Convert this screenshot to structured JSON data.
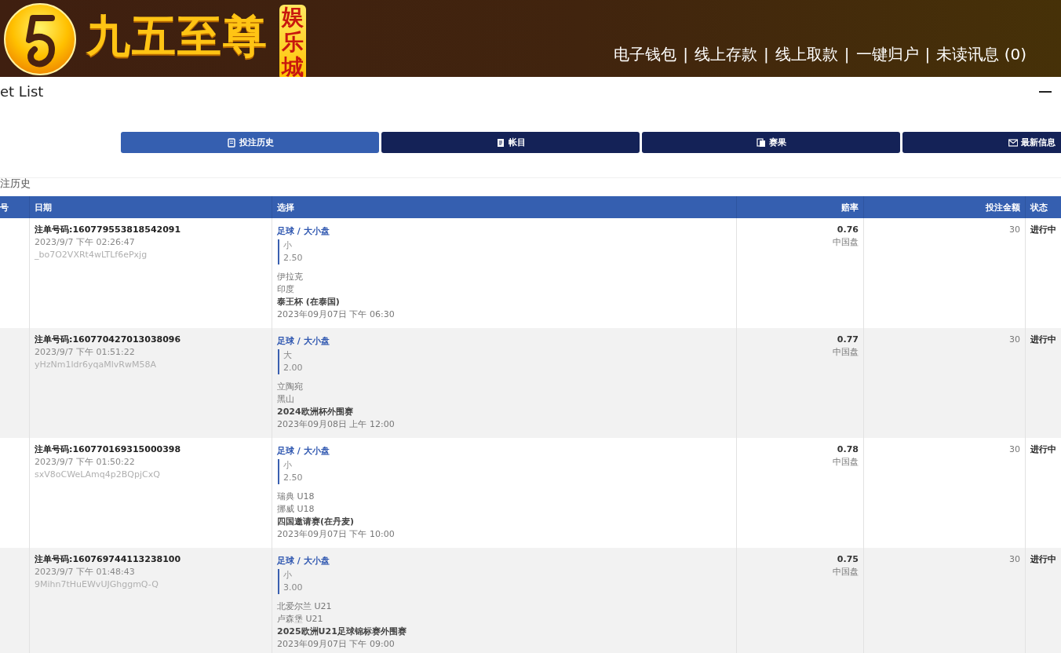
{
  "header": {
    "logo_title": "九五至尊",
    "logo_badge": "娱乐城",
    "nav_links": [
      {
        "label": "电子钱包"
      },
      {
        "label": "线上存款"
      },
      {
        "label": "线上取款"
      },
      {
        "label": "一键归户"
      },
      {
        "label": "未读讯息 (0)"
      }
    ],
    "separator": "|"
  },
  "modal": {
    "title": "et List",
    "tabs": [
      {
        "label": "投注历史",
        "kind": "history",
        "selected": true
      },
      {
        "label": "帐目",
        "kind": "account",
        "selected": false
      },
      {
        "label": "赛果",
        "kind": "results",
        "selected": false
      },
      {
        "label": "最新信息",
        "kind": "messages",
        "selected": false
      }
    ],
    "section_title": "注历史",
    "table": {
      "columns": [
        "号",
        "日期",
        "选择",
        "赔率",
        "投注金额",
        "状态"
      ],
      "rows": [
        {
          "bet_no": "注单号码:160779553818542091",
          "placed": "2023/9/7 下午 02:26:47",
          "ref": "_bo7O2VXRt4wLTLf6ePxjg",
          "market": "足球 / 大小盘",
          "pick": "小",
          "line": "2.50",
          "home": "伊拉克",
          "away": "印度",
          "league": "泰王杯 (在泰国)",
          "kickoff": "2023年09月07日 下午 06:30",
          "odds": "0.76",
          "odds_type": "中国盘",
          "stake": "30",
          "status": "进行中"
        },
        {
          "bet_no": "注单号码:160770427013038096",
          "placed": "2023/9/7 下午 01:51:22",
          "ref": "yHzNm1ldr6yqaMlvRwM58A",
          "market": "足球 / 大小盘",
          "pick": "大",
          "line": "2.00",
          "home": "立陶宛",
          "away": "黑山",
          "league": "2024欧洲杯外围赛",
          "kickoff": "2023年09月08日 上午 12:00",
          "odds": "0.77",
          "odds_type": "中国盘",
          "stake": "30",
          "status": "进行中"
        },
        {
          "bet_no": "注单号码:160770169315000398",
          "placed": "2023/9/7 下午 01:50:22",
          "ref": "sxV8oCWeLAmq4p2BQpjCxQ",
          "market": "足球 / 大小盘",
          "pick": "小",
          "line": "2.50",
          "home": "瑞典 U18",
          "away": "挪威 U18",
          "league": "四国邀请赛(在丹麦)",
          "kickoff": "2023年09月07日 下午 10:00",
          "odds": "0.78",
          "odds_type": "中国盘",
          "stake": "30",
          "status": "进行中"
        },
        {
          "bet_no": "注单号码:160769744113238100",
          "placed": "2023/9/7 下午 01:48:43",
          "ref": "9Mihn7tHuEWvUJGhggmQ-Q",
          "market": "足球 / 大小盘",
          "pick": "小",
          "line": "3.00",
          "home": "北爱尔兰 U21",
          "away": "卢森堡 U21",
          "league": "2025欧洲U21足球锦标赛外围赛",
          "kickoff": "2023年09月07日 下午 09:00",
          "odds": "0.75",
          "odds_type": "中国盘",
          "stake": "30",
          "status": "进行中"
        }
      ]
    }
  }
}
